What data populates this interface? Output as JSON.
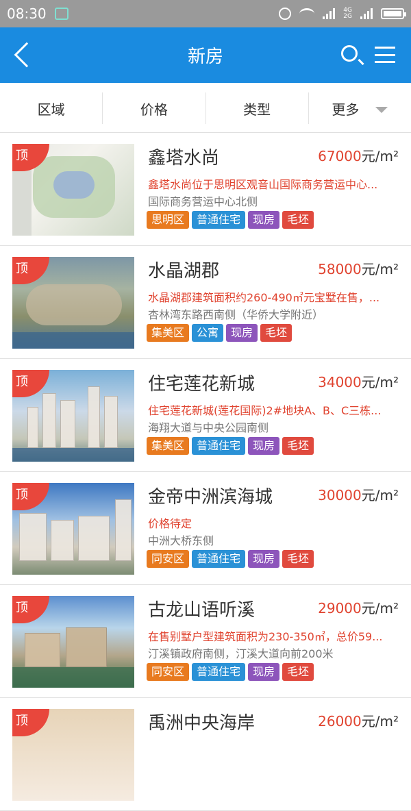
{
  "status_bar": {
    "time": "08:30",
    "network": [
      "4G",
      "2G"
    ]
  },
  "header": {
    "title": "新房"
  },
  "filters": [
    "区域",
    "价格",
    "类型",
    "更多"
  ],
  "listings": [
    {
      "badge": "顶",
      "name": "鑫塔水尚",
      "price": "67000",
      "unit": "元/m²",
      "desc": "鑫塔水尚位于思明区观音山国际商务营运中心...",
      "addr": "国际商务营运中心北侧",
      "tags": [
        "思明区",
        "普通住宅",
        "现房",
        "毛坯"
      ]
    },
    {
      "badge": "顶",
      "name": "水晶湖郡",
      "price": "58000",
      "unit": "元/m²",
      "desc": "水晶湖郡建筑面积约260-490㎡元宝墅在售，...",
      "addr": "杏林湾东路西南侧（华侨大学附近）",
      "tags": [
        "集美区",
        "公寓",
        "现房",
        "毛坯"
      ]
    },
    {
      "badge": "顶",
      "name": "住宅莲花新城",
      "price": "34000",
      "unit": "元/m²",
      "desc": "住宅莲花新城(莲花国际)2#地块A、B、C三栋...",
      "addr": "海翔大道与中央公园南侧",
      "tags": [
        "集美区",
        "普通住宅",
        "现房",
        "毛坯"
      ]
    },
    {
      "badge": "顶",
      "name": "金帝中洲滨海城",
      "price": "30000",
      "unit": "元/m²",
      "desc": "价格待定",
      "addr": "中洲大桥东侧",
      "tags": [
        "同安区",
        "普通住宅",
        "现房",
        "毛坯"
      ]
    },
    {
      "badge": "顶",
      "name": "古龙山语听溪",
      "price": "29000",
      "unit": "元/m²",
      "desc": "在售别墅户型建筑面积为230-350㎡，总价59...",
      "addr": "汀溪镇政府南侧，汀溪大道向前200米",
      "tags": [
        "同安区",
        "普通住宅",
        "现房",
        "毛坯"
      ]
    },
    {
      "badge": "顶",
      "name": "禹洲中央海岸",
      "price": "26000",
      "unit": "元/m²",
      "desc": "",
      "addr": "",
      "tags": []
    }
  ],
  "colors": {
    "header": "#1a8be0",
    "price": "#e0432f",
    "badge": "#e8473c",
    "tag_district": "#e87a1f",
    "tag_type": "#2a91d6",
    "tag_status": "#8d55bb",
    "tag_finish": "#e04a3e"
  }
}
